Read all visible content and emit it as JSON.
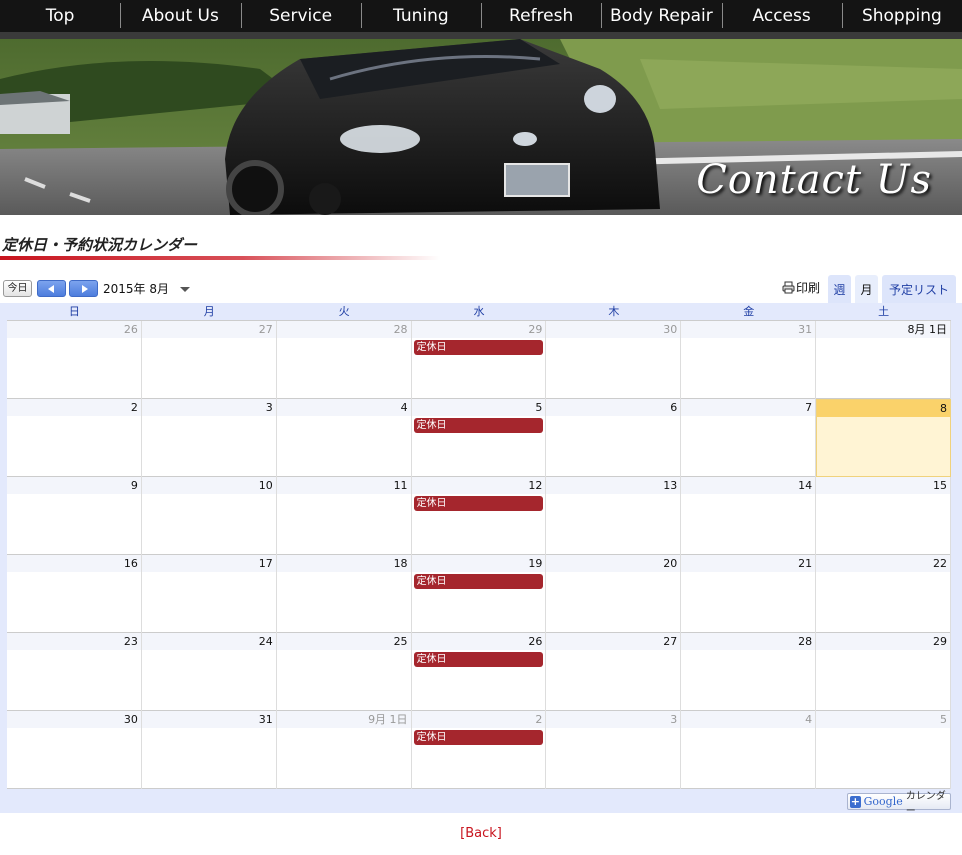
{
  "nav": {
    "items": [
      "Top",
      "About Us",
      "Service",
      "Tuning",
      "Refresh",
      "Body Repair",
      "Access",
      "Shopping"
    ]
  },
  "hero": {
    "title": "Contact Us"
  },
  "section": {
    "title": "定休日・予約状況カレンダー"
  },
  "toolbar": {
    "today": "今日",
    "month": "2015年 8月",
    "print": "印刷",
    "week_tab": "週",
    "month_tab": "月",
    "agenda_tab": "予定リスト"
  },
  "calendar": {
    "weekdays": [
      "日",
      "月",
      "火",
      "水",
      "木",
      "金",
      "土"
    ],
    "weeks": [
      [
        {
          "n": "26",
          "o": true
        },
        {
          "n": "27",
          "o": true
        },
        {
          "n": "28",
          "o": true
        },
        {
          "n": "29",
          "o": true,
          "e": "定休日"
        },
        {
          "n": "30",
          "o": true
        },
        {
          "n": "31",
          "o": true
        },
        {
          "n": "8月 1日"
        }
      ],
      [
        {
          "n": "2"
        },
        {
          "n": "3"
        },
        {
          "n": "4"
        },
        {
          "n": "5",
          "e": "定休日"
        },
        {
          "n": "6"
        },
        {
          "n": "7"
        },
        {
          "n": "8",
          "today": true
        }
      ],
      [
        {
          "n": "9"
        },
        {
          "n": "10"
        },
        {
          "n": "11"
        },
        {
          "n": "12",
          "e": "定休日"
        },
        {
          "n": "13"
        },
        {
          "n": "14"
        },
        {
          "n": "15"
        }
      ],
      [
        {
          "n": "16"
        },
        {
          "n": "17"
        },
        {
          "n": "18"
        },
        {
          "n": "19",
          "e": "定休日"
        },
        {
          "n": "20"
        },
        {
          "n": "21"
        },
        {
          "n": "22"
        }
      ],
      [
        {
          "n": "23"
        },
        {
          "n": "24"
        },
        {
          "n": "25"
        },
        {
          "n": "26",
          "e": "定休日"
        },
        {
          "n": "27"
        },
        {
          "n": "28"
        },
        {
          "n": "29"
        }
      ],
      [
        {
          "n": "30"
        },
        {
          "n": "31"
        },
        {
          "n": "9月 1日",
          "o": true
        },
        {
          "n": "2",
          "o": true,
          "e": "定休日"
        },
        {
          "n": "3",
          "o": true
        },
        {
          "n": "4",
          "o": true
        },
        {
          "n": "5",
          "o": true
        }
      ]
    ],
    "badge_google": "Google",
    "badge_text": "カレンダー"
  },
  "footer": {
    "back": "[Back]"
  },
  "colors": {
    "event": "#a5262d",
    "today": "#fad26a",
    "accent": "#c8141e"
  }
}
